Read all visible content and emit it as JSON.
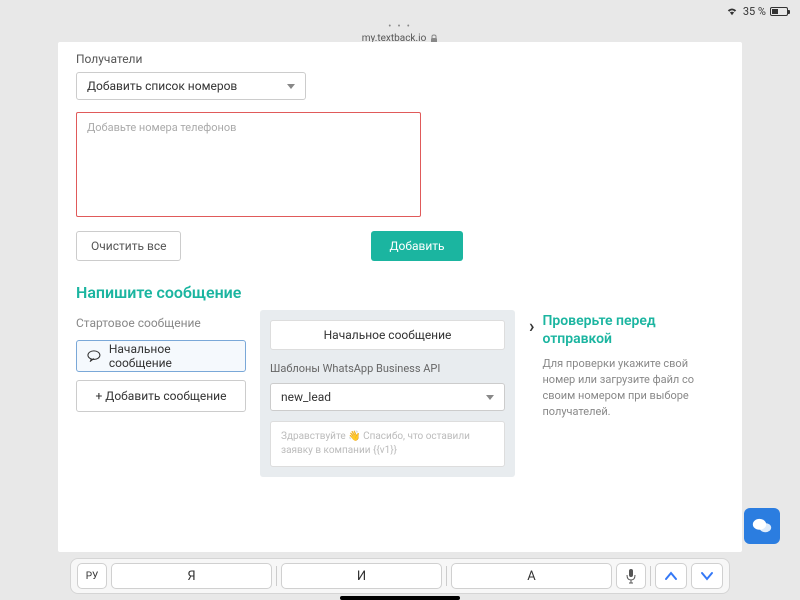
{
  "statusbar": {
    "battery_pct": "35 %",
    "wifi": "wifi-icon"
  },
  "browser": {
    "url": "my.textback.io"
  },
  "recipients": {
    "label": "Получатели",
    "select_value": "Добавить список номеров",
    "textarea_placeholder": "Добавьте номера телефонов",
    "clear_btn": "Очистить все",
    "add_btn": "Добавить"
  },
  "compose": {
    "title": "Напишите сообщение",
    "sublabel": "Стартовое сообщение",
    "items": [
      {
        "label": "Начальное сообщение"
      },
      {
        "label": "+ Добавить сообщение"
      }
    ]
  },
  "editor": {
    "header": "Начальное сообщение",
    "templates_label": "Шаблоны WhatsApp Business API",
    "template_value": "new_lead",
    "preview": "Здравствуйте 👋 Спасибо, что оставили заявку в компании {{v1}}"
  },
  "verify": {
    "title": "Проверьте перед отправкой",
    "text": "Для проверки укажите свой номер или загрузите файл со своим номером при выборе получателей."
  },
  "keyboard": {
    "lang": "РУ",
    "k1": "Я",
    "k2": "И",
    "k3": "А"
  }
}
